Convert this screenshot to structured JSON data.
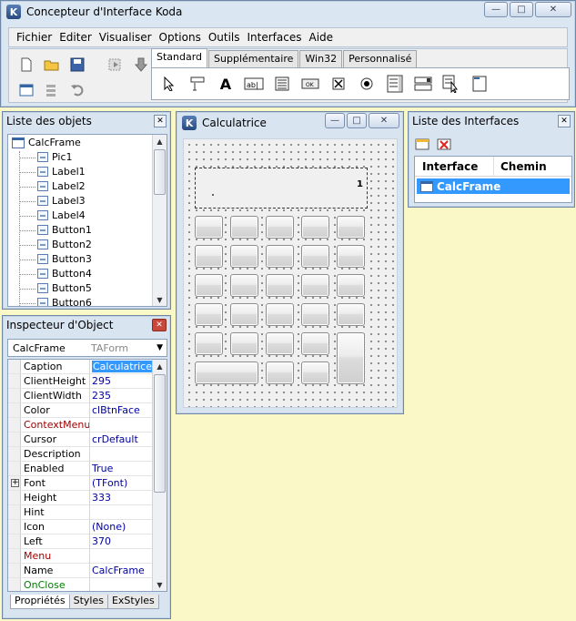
{
  "main_window": {
    "title": "Concepteur d'Interface Koda",
    "app_icon": "K",
    "menu": [
      "Fichier",
      "Editer",
      "Visualiser",
      "Options",
      "Outils",
      "Interfaces",
      "Aide"
    ],
    "tabs": [
      "Standard",
      "Supplémentaire",
      "Win32",
      "Personnalisé"
    ],
    "active_tab": "Standard"
  },
  "objects_panel": {
    "title": "Liste des objets",
    "root": "CalcFrame",
    "items": [
      "Pic1",
      "Label1",
      "Label2",
      "Label3",
      "Label4",
      "Button1",
      "Button2",
      "Button3",
      "Button4",
      "Button5",
      "Button6"
    ]
  },
  "inspector": {
    "title": "Inspecteur d'Object",
    "object_name": "CalcFrame",
    "object_type": "TAForm",
    "properties": [
      {
        "name": "Caption",
        "value": "Calculatrice",
        "color": "#000000",
        "selected": true
      },
      {
        "name": "ClientHeight",
        "value": "295",
        "color": "#000000"
      },
      {
        "name": "ClientWidth",
        "value": "235",
        "color": "#000000"
      },
      {
        "name": "Color",
        "value": "clBtnFace",
        "color": "#000000"
      },
      {
        "name": "ContextMenu",
        "value": "",
        "color": "#a00000"
      },
      {
        "name": "Cursor",
        "value": "crDefault",
        "color": "#000000"
      },
      {
        "name": "Description",
        "value": "",
        "color": "#000000"
      },
      {
        "name": "Enabled",
        "value": "True",
        "color": "#000000"
      },
      {
        "name": "Font",
        "value": "(TFont)",
        "color": "#000000",
        "expandable": true
      },
      {
        "name": "Height",
        "value": "333",
        "color": "#000000"
      },
      {
        "name": "Hint",
        "value": "",
        "color": "#000000"
      },
      {
        "name": "Icon",
        "value": "(None)",
        "color": "#000000"
      },
      {
        "name": "Left",
        "value": "370",
        "color": "#000000"
      },
      {
        "name": "Menu",
        "value": "",
        "color": "#a00000"
      },
      {
        "name": "Name",
        "value": "CalcFrame",
        "color": "#000000"
      },
      {
        "name": "OnClose",
        "value": "",
        "color": "#008000"
      }
    ],
    "bottom_tabs": [
      "Propriétés",
      "Styles",
      "ExStyles"
    ]
  },
  "calc_window": {
    "title": "Calculatrice",
    "display_value": "1"
  },
  "interfaces_panel": {
    "title": "Liste des Interfaces",
    "columns": [
      "Interface",
      "Chemin"
    ],
    "rows": [
      {
        "interface": "CalcFrame",
        "path": ""
      }
    ]
  },
  "colors": {
    "accent_selection": "#3399ff",
    "desktop_background": "#fbf8c8"
  }
}
